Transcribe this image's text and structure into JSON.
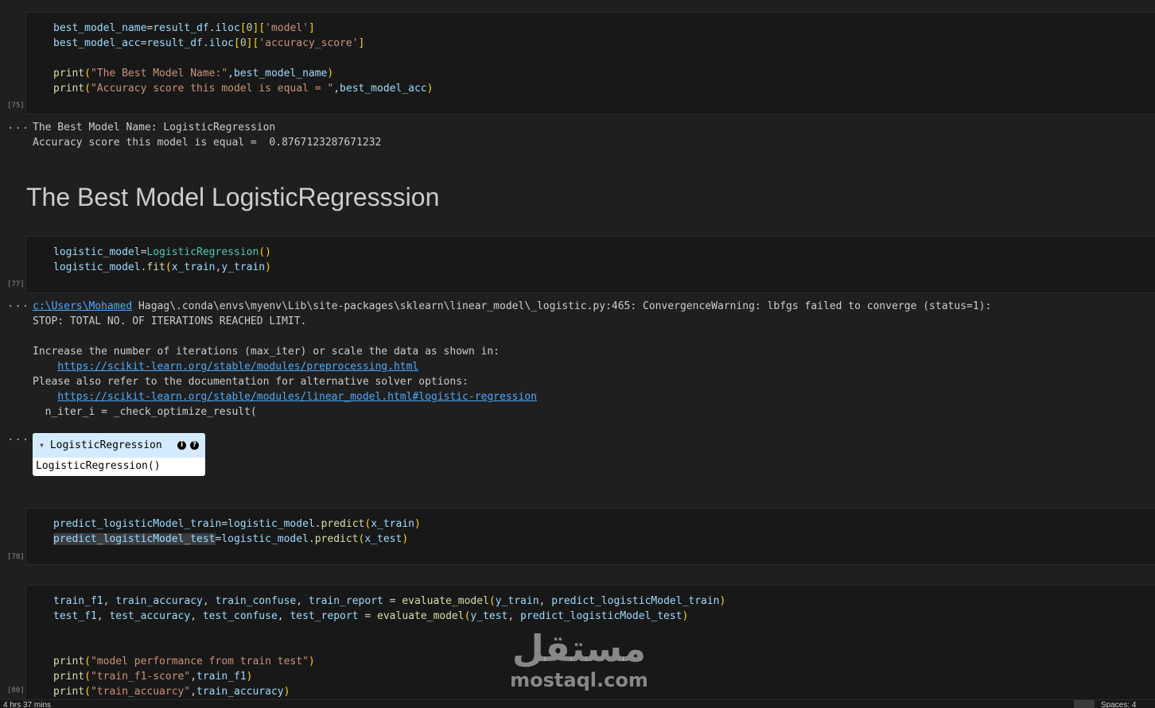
{
  "cells": [
    {
      "exec_count": "[75]",
      "code_lines": [
        "best_model_name=result_df.iloc[0]['model']",
        "best_model_acc=result_df.iloc[0]['accuracy_score']",
        "",
        "print(\"The Best Model Name:\",best_model_name)",
        "print(\"Accuracy score this model is equal = \",best_model_acc)"
      ],
      "output_lines": [
        "The Best Model Name: LogisticRegression",
        "Accuracy score this model is equal =  0.8767123287671232"
      ]
    },
    {
      "markdown_heading": "The Best Model LogisticRegresssion"
    },
    {
      "exec_count": "[77]",
      "code_lines": [
        "logistic_model=LogisticRegression()",
        "logistic_model.fit(x_train,y_train)"
      ],
      "warning": {
        "path_link": "c:\\Users\\Mohamed",
        "line1_rest": " Hagag\\.conda\\envs\\myenv\\Lib\\site-packages\\sklearn\\linear_model\\_logistic.py:465: ConvergenceWarning: lbfgs failed to converge (status=1):",
        "line2": "STOP: TOTAL NO. OF ITERATIONS REACHED LIMIT.",
        "line3": "Increase the number of iterations (max_iter) or scale the data as shown in:",
        "link1": "https://scikit-learn.org/stable/modules/preprocessing.html",
        "line4": "Please also refer to the documentation for alternative solver options:",
        "link2": "https://scikit-learn.org/stable/modules/linear_model.html#logistic-regression",
        "line5": "  n_iter_i = _check_optimize_result("
      },
      "estimator_widget": {
        "title": "LogisticRegression",
        "info_badge": "i",
        "help_badge": "?",
        "repr": "LogisticRegression()"
      }
    },
    {
      "exec_count": "[78]",
      "code_lines": [
        "predict_logisticModel_train=logistic_model.predict(x_train)",
        "predict_logisticModel_test=logistic_model.predict(x_test)"
      ]
    },
    {
      "exec_count": "[80]",
      "code_lines": [
        "train_f1, train_accuracy, train_confuse, train_report = evaluate_model(y_train, predict_logisticModel_train)",
        "test_f1, test_accuracy, test_confuse, test_report = evaluate_model(y_test, predict_logisticModel_test)",
        "",
        "",
        "print(\"model performance from train test\")",
        "print(\"train_f1-score\",train_f1)",
        "print(\"train_accuarcy\",train_accuracy)"
      ]
    }
  ],
  "output_ellipsis": "...",
  "status_bar": {
    "left": "4 hrs 37 mins",
    "right": "Spaces: 4"
  },
  "watermark": {
    "arabic": "مستقل",
    "latin": "mostaql.com"
  }
}
